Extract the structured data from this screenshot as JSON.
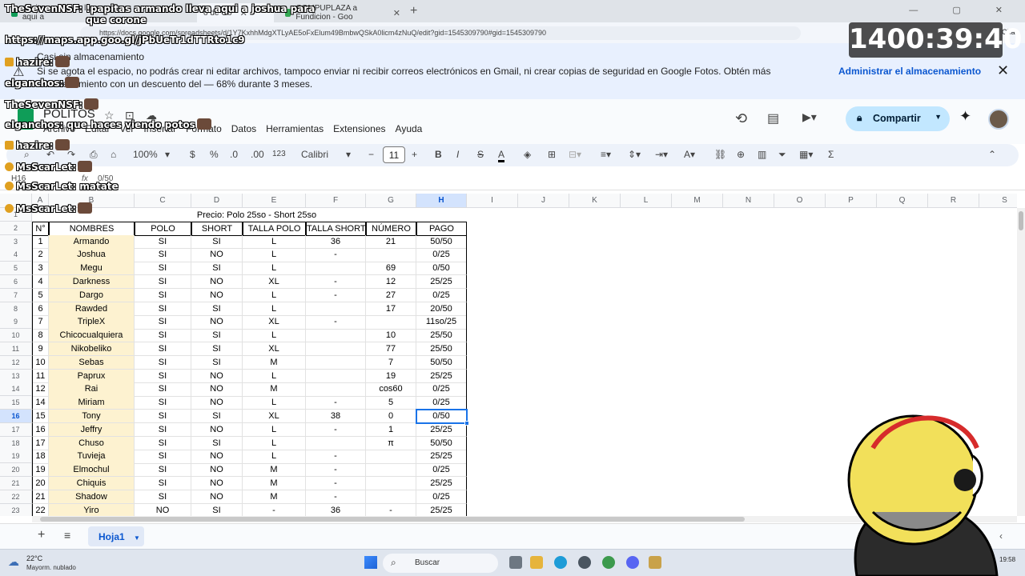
{
  "browser": {
    "tabs": [
      {
        "label": "papitas armando lleva aqui a",
        "active": false
      },
      {
        "label": "o de Go",
        "active": true
      },
      {
        "label": "COMPUPLAZA a Fundicion - Goo",
        "active": false
      }
    ],
    "url": "https://docs.google.com/spreadsheets/d/1Y7KxhhMdgXTLyAE5oFxElum49BmbwQSkA0licm4zNuQ/edit?gid=1545309790#gid=1545309790",
    "chat_label": "Chat"
  },
  "banner": {
    "title": "Casi sin almacenamiento",
    "text": "Si se agota el espacio, no podrás crear ni editar archivos, tampoco enviar ni recibir correos electrónicos en Gmail, ni crear copias de seguridad en Google Fotos. Obtén más almacenamiento con un descuento del — 68% durante 3 meses.",
    "manage_label": "Administrar el almacenamiento"
  },
  "sheets": {
    "doc_title": "POLITOS",
    "menu": [
      "Archivo",
      "Editar",
      "Ver",
      "Insertar",
      "Formato",
      "Datos",
      "Herramientas",
      "Extensiones",
      "Ayuda"
    ],
    "share_label": "Compartir",
    "toolbar": {
      "zoom": "100%",
      "currency": "$",
      "percent": "%",
      "dec_less": ".0",
      "dec_more": ".00",
      "format_num": "123",
      "font": "Calibri",
      "font_size": "11",
      "bold": "B",
      "italic": "I",
      "strike": "S",
      "text_color": "A",
      "sum": "Σ"
    },
    "name_box": "H16",
    "formula_value": "0/50",
    "column_headers": [
      "A",
      "B",
      "C",
      "D",
      "E",
      "F",
      "G",
      "H",
      "I",
      "J",
      "K",
      "L",
      "M",
      "N",
      "O",
      "P",
      "Q",
      "R",
      "S"
    ],
    "selected_column": "H",
    "selected_row": "16",
    "price_title": "Precio: Polo 25so - Short 25so",
    "table_headers": [
      "N°",
      "NOMBRES",
      "POLO",
      "SHORT",
      "TALLA POLO",
      "TALLA SHORT",
      "NÚMERO",
      "PAGO"
    ],
    "rows": [
      [
        "1",
        "Armando",
        "SI",
        "SI",
        "L",
        "36",
        "21",
        "50/50"
      ],
      [
        "2",
        "Joshua",
        "SI",
        "NO",
        "L",
        "-",
        "",
        "0/25"
      ],
      [
        "3",
        "Megu",
        "SI",
        "SI",
        "L",
        "",
        "69",
        "0/50"
      ],
      [
        "4",
        "Darkness",
        "SI",
        "NO",
        "XL",
        "-",
        "12",
        "25/25"
      ],
      [
        "5",
        "Dargo",
        "SI",
        "NO",
        "L",
        "-",
        "27",
        "0/25"
      ],
      [
        "6",
        "Rawded",
        "SI",
        "SI",
        "L",
        "",
        "17",
        "20/50"
      ],
      [
        "7",
        "TripleX",
        "SI",
        "NO",
        "XL",
        "-",
        "",
        "11so/25"
      ],
      [
        "8",
        "Chicocualquiera",
        "SI",
        "SI",
        "L",
        "",
        "10",
        "25/50"
      ],
      [
        "9",
        "Nikobeliko",
        "SI",
        "SI",
        "XL",
        "",
        "77",
        "25/50"
      ],
      [
        "10",
        "Sebas",
        "SI",
        "SI",
        "M",
        "",
        "7",
        "50/50"
      ],
      [
        "11",
        "Paprux",
        "SI",
        "NO",
        "L",
        "",
        "19",
        "25/25"
      ],
      [
        "12",
        "Rai",
        "SI",
        "NO",
        "M",
        "",
        "cos60",
        "0/25"
      ],
      [
        "14",
        "Miriam",
        "SI",
        "NO",
        "L",
        "-",
        "5",
        "0/25"
      ],
      [
        "15",
        "Tony",
        "SI",
        "SI",
        "XL",
        "38",
        "0",
        "0/50"
      ],
      [
        "16",
        "Jeffry",
        "SI",
        "NO",
        "L",
        "-",
        "1",
        "25/25"
      ],
      [
        "17",
        "Chuso",
        "SI",
        "SI",
        "L",
        "",
        "π",
        "50/50"
      ],
      [
        "18",
        "Tuvieja",
        "SI",
        "NO",
        "L",
        "-",
        "",
        "25/25"
      ],
      [
        "19",
        "Elmochul",
        "SI",
        "NO",
        "M",
        "-",
        "",
        "0/25"
      ],
      [
        "20",
        "Chiquis",
        "SI",
        "NO",
        "M",
        "-",
        "",
        "25/25"
      ],
      [
        "21",
        "Shadow",
        "SI",
        "NO",
        "M",
        "-",
        "",
        "0/25"
      ],
      [
        "22",
        "Yiro",
        "NO",
        "SI",
        "-",
        "36",
        "-",
        "25/25"
      ]
    ],
    "row_numbers": [
      "1",
      "2",
      "3",
      "4",
      "5",
      "6",
      "7",
      "8",
      "9",
      "10",
      "11",
      "12",
      "13",
      "14",
      "15",
      "16",
      "17",
      "18",
      "19",
      "20",
      "21",
      "22",
      "23"
    ],
    "sheet_tab": "Hoja1"
  },
  "taskbar": {
    "temp": "22°C",
    "weather": "Mayorm. nublado",
    "search_placeholder": "Buscar",
    "clock": "19:58"
  },
  "overlay": {
    "timer": "1400:39:40",
    "messages": [
      {
        "user": "TheSevenNSF:",
        "text": "!papitas armando lleva aqui a joshua para que corone"
      },
      {
        "user": "",
        "text": "https://maps.app.goo.gl/jPbUeTr1dTTRto1c9"
      },
      {
        "user": "hazire:",
        "text": ""
      },
      {
        "user": "elganchos:",
        "text": ""
      },
      {
        "user": "TheSevenNSF:",
        "text": ""
      },
      {
        "user": "elganchos:",
        "text": "que haces viendo potos"
      },
      {
        "user": "hazire:",
        "text": ""
      },
      {
        "user": "MsScarLet:",
        "text": ""
      },
      {
        "user": "MsScarLet:",
        "text": "matate"
      },
      {
        "user": "MsScarLet:",
        "text": ""
      }
    ]
  },
  "colors": {
    "accent": "#0b57d0",
    "share_bg": "#c2e7ff",
    "banner_bg": "#e8f0fe",
    "name_fill": "#fdf2d0",
    "selection": "#1a73e8"
  }
}
